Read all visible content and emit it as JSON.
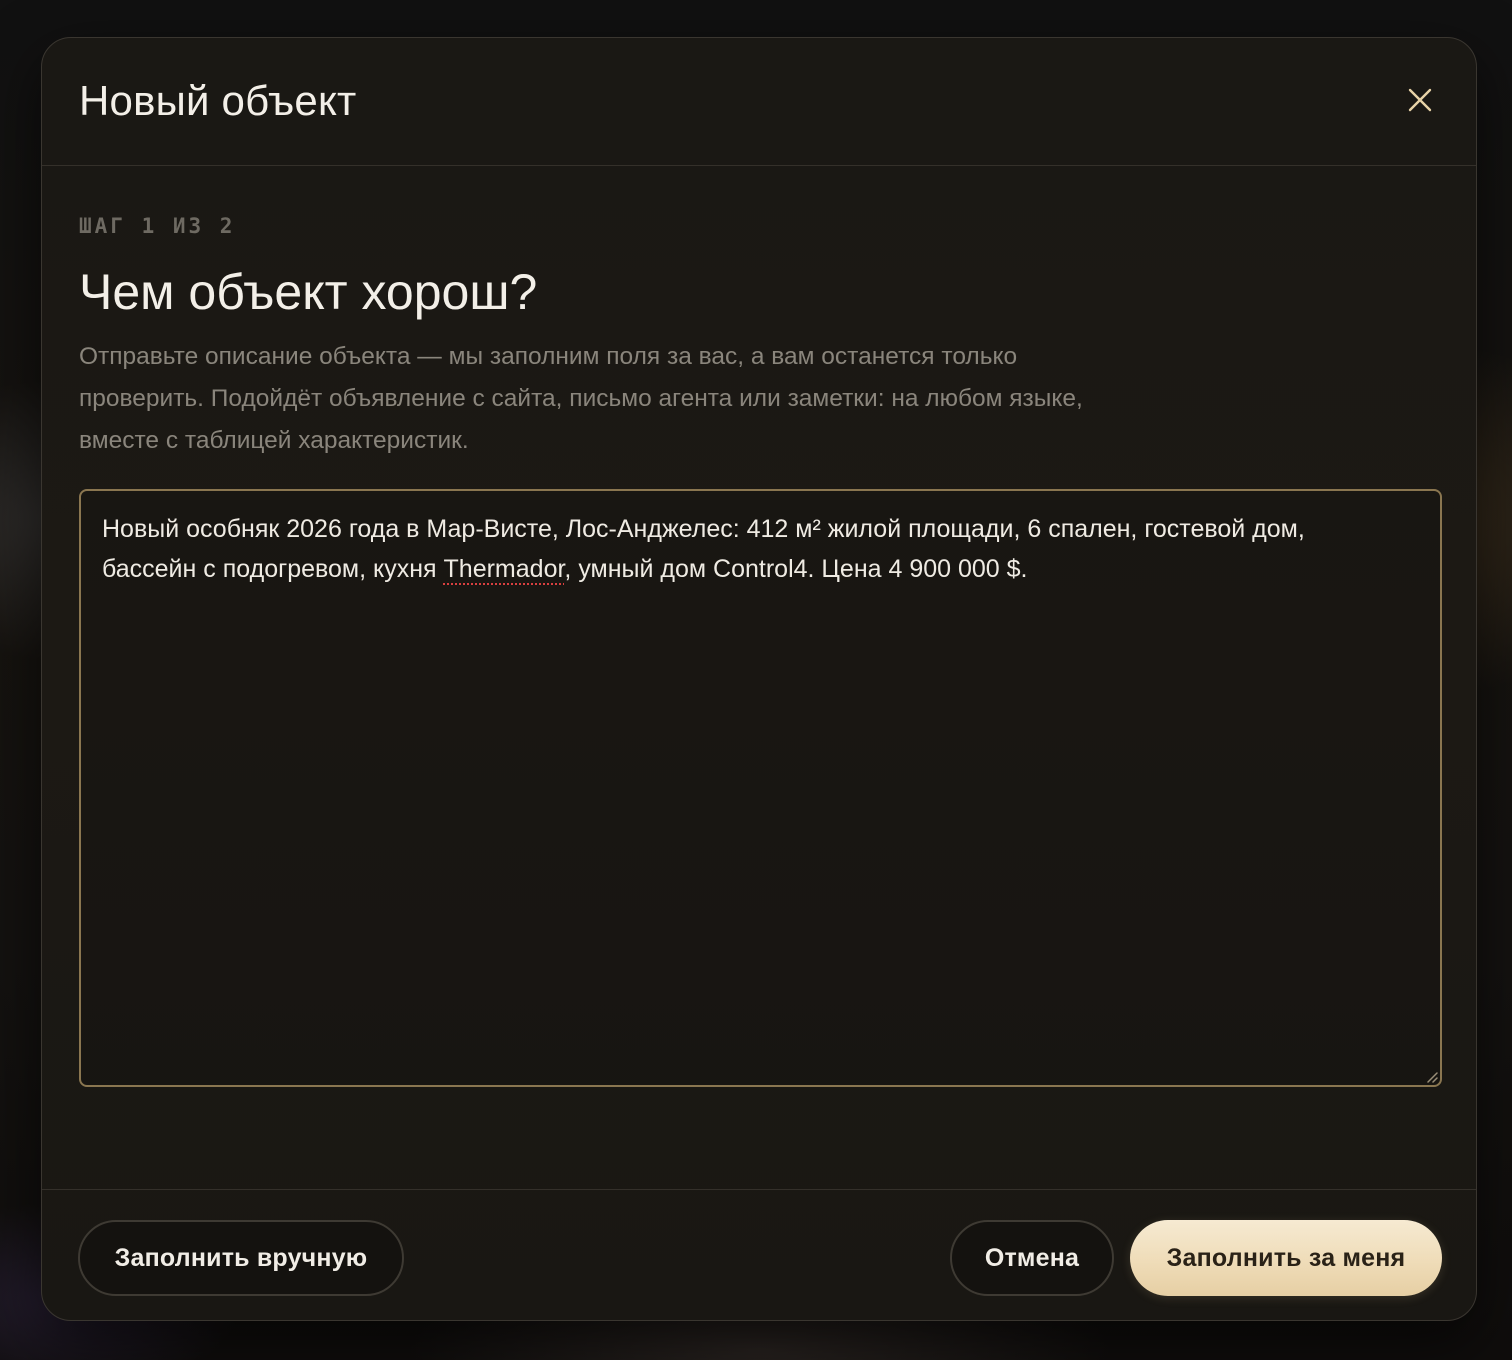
{
  "modal": {
    "title": "Новый объект",
    "close_icon": "close-icon"
  },
  "step": {
    "label": "ШАГ 1 ИЗ 2",
    "question": "Чем объект хорош?",
    "description": "Отправьте описание объекта — мы заполним поля за вас, а вам останется только проверить. Подойдёт объявление с сайта, письмо агента или заметки: на любом языке, вместе с таблицей характеристик."
  },
  "textarea": {
    "value_before": "Новый особняк 2026 года в Мар-Висте, Лос-Анджелес: 412 м² жилой площади, 6 спален, гостевой дом, бассейн с подогревом, кухня ",
    "value_misspelled": "Thermador",
    "value_after": ", умный дом Control4. Цена 4 900 000 $."
  },
  "footer": {
    "manual_label": "Заполнить вручную",
    "cancel_label": "Отмена",
    "autofill_label": "Заполнить за меня"
  },
  "colors": {
    "accent_border": "#8a7650",
    "primary_button": "#efdcb8",
    "background": "#1a1814"
  }
}
